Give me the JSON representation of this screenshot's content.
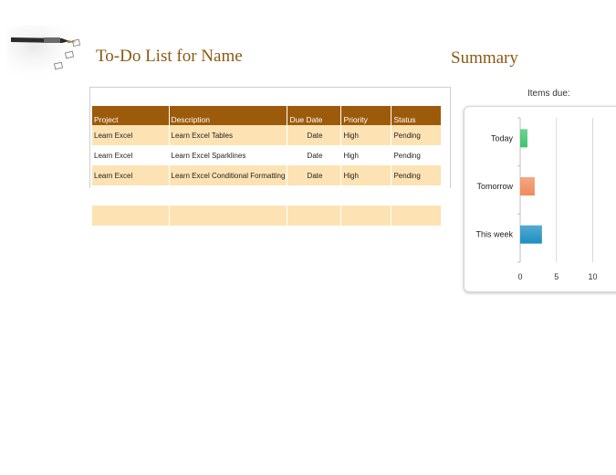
{
  "page": {
    "title": "To-Do List for Name",
    "summary_title": "Summary"
  },
  "table": {
    "headers": [
      "Project",
      "Description",
      "Due Date",
      "Priority",
      "Status"
    ],
    "rows": [
      [
        "Learn Excel",
        "Learn Excel Tables",
        "Date",
        "High",
        "Pending"
      ],
      [
        "Learn Excel",
        "Learn Excel Sparklines",
        "Date",
        "High",
        "Pending"
      ],
      [
        "Learn Excel",
        "Learn Excel Conditional Formatting",
        "Date",
        "High",
        "Pending"
      ],
      [
        "",
        "",
        "",
        "",
        ""
      ],
      [
        "",
        "",
        "",
        "",
        ""
      ]
    ]
  },
  "chart_data": {
    "type": "bar",
    "orientation": "horizontal",
    "title": "Items due:",
    "categories": [
      "Today",
      "Tomorrow",
      "This week"
    ],
    "values": [
      1,
      2,
      3
    ],
    "colors": [
      "#3ec46d",
      "#f08a5a",
      "#1c8fc2"
    ],
    "xlim": [
      0,
      20
    ],
    "xticks": [
      0,
      5,
      10,
      15
    ],
    "grid": true
  },
  "colors": {
    "header_bg": "#9c5b0b",
    "band_bg": "#fde3b3",
    "title_color": "#8a5a14"
  }
}
